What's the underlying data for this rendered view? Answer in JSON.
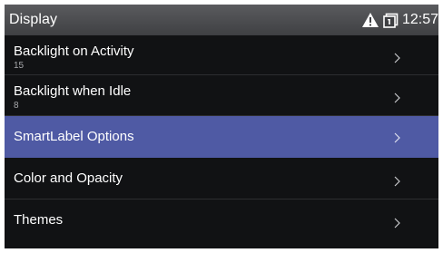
{
  "header": {
    "title": "Display",
    "status_icons": [
      "warning-icon",
      "device-icon"
    ],
    "time": "12:57"
  },
  "menu": {
    "items": [
      {
        "label": "Backlight on Activity",
        "value": "15",
        "selected": false
      },
      {
        "label": "Backlight when Idle",
        "value": "8",
        "selected": false
      },
      {
        "label": "SmartLabel Options",
        "value": "",
        "selected": true
      },
      {
        "label": "Color and Opacity",
        "value": "",
        "selected": false
      },
      {
        "label": "Themes",
        "value": "",
        "selected": false
      }
    ]
  },
  "colors": {
    "background": "#111214",
    "titlebar": "#4a4b4e",
    "selected": "#4f5aa4",
    "text": "#ffffff",
    "subtext": "#a7a8ab"
  }
}
